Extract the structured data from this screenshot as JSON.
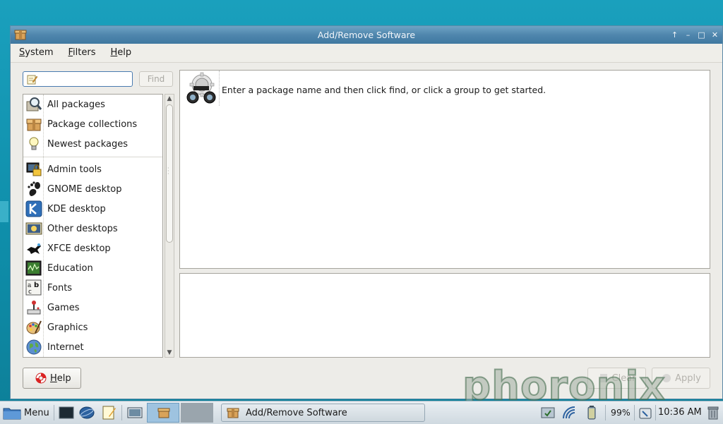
{
  "window": {
    "title": "Add/Remove Software"
  },
  "menubar": {
    "items": [
      {
        "label_ul": "S",
        "label_rest": "ystem"
      },
      {
        "label_ul": "F",
        "label_rest": "ilters"
      },
      {
        "label_ul": "H",
        "label_rest": "elp"
      }
    ]
  },
  "search": {
    "value": "",
    "find_label": "Find"
  },
  "groups": {
    "collections": [
      {
        "label": "All packages",
        "icon": "magnifier-icon"
      },
      {
        "label": "Package collections",
        "icon": "package-box-icon"
      },
      {
        "label": "Newest packages",
        "icon": "lightbulb-icon"
      }
    ],
    "categories": [
      {
        "label": "Admin tools",
        "icon": "admin-lock-icon"
      },
      {
        "label": "GNOME desktop",
        "icon": "gnome-foot-icon"
      },
      {
        "label": "KDE desktop",
        "icon": "kde-logo-icon"
      },
      {
        "label": "Other desktops",
        "icon": "desktop-icon"
      },
      {
        "label": "XFCE desktop",
        "icon": "xfce-mouse-icon"
      },
      {
        "label": "Education",
        "icon": "education-icon"
      },
      {
        "label": "Fonts",
        "icon": "fonts-icon"
      },
      {
        "label": "Games",
        "icon": "joystick-icon"
      },
      {
        "label": "Graphics",
        "icon": "palette-icon"
      },
      {
        "label": "Internet",
        "icon": "globe-icon"
      }
    ]
  },
  "info": {
    "message": "Enter a package name and then click find, or click a group to get started."
  },
  "buttons": {
    "help_ul": "H",
    "help_rest": "elp",
    "clear": "Clear",
    "apply": "Apply"
  },
  "watermark": "phoronix",
  "taskbar": {
    "menu_label": "Menu",
    "task_label": "Add/Remove Software",
    "battery": "99%",
    "clock": "10:36 AM"
  }
}
